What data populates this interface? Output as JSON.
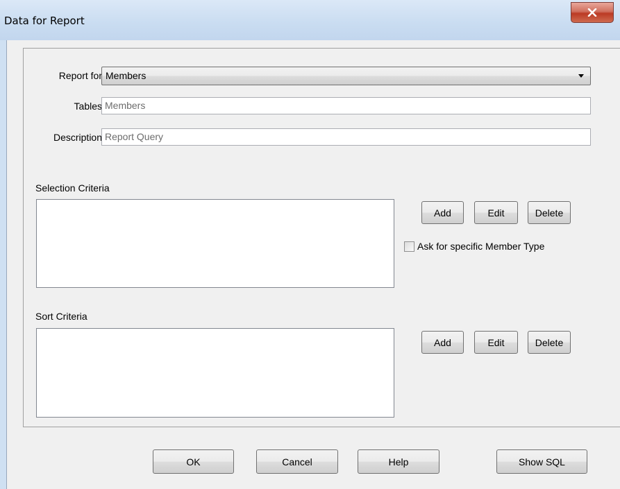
{
  "window": {
    "title": "Data for Report",
    "close_glyph": "X"
  },
  "form": {
    "report_for_label": "Report for",
    "report_for_value": "Members",
    "tables_label": "Tables",
    "tables_value": "Members",
    "description_label": "Description",
    "description_value": "Report Query"
  },
  "selection": {
    "label": "Selection Criteria",
    "add": "Add",
    "edit": "Edit",
    "delete": "Delete",
    "ask_checkbox_label": "Ask for specific Member Type",
    "ask_checked": false
  },
  "sort": {
    "label": "Sort Criteria",
    "add": "Add",
    "edit": "Edit",
    "delete": "Delete"
  },
  "footer": {
    "ok": "OK",
    "cancel": "Cancel",
    "help": "Help",
    "show_sql": "Show SQL"
  },
  "icons": {
    "close": "close-icon",
    "dropdown": "chevron-down-icon"
  },
  "colors": {
    "titlebar": "#c9dcf1",
    "close_button": "#c7432f",
    "dialog_bg": "#f0f0f0"
  }
}
